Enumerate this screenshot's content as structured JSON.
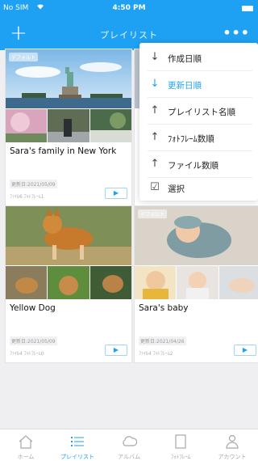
{
  "status": {
    "carrier": "No SIM",
    "time": "4:50 PM"
  },
  "nav": {
    "title": "プレイリスト",
    "add": "+",
    "more": "•••"
  },
  "cards": [
    {
      "tag": "デフォルト",
      "title": "Sara's family in New York",
      "date": "更新日:2021/05/09",
      "counts": "ﾌｧｲﾙ6  ﾌｫﾄﾌﾚｰﾑ1",
      "play": "▶"
    },
    {
      "tag": "",
      "title": "",
      "date": "",
      "counts": "",
      "play": ""
    },
    {
      "tag": "",
      "title": "Yellow Dog",
      "date": "更新日:2021/05/09",
      "counts": "ﾌｧｲﾙ4  ﾌｫﾄﾌﾚｰﾑ0",
      "play": "▶"
    },
    {
      "tag": "デフォルト",
      "title": "Sara's baby",
      "date": "更新日:2021/04/26",
      "counts": "ﾌｧｲﾙ4  ﾌｫﾄﾌﾚｰﾑ2",
      "play": "▶"
    }
  ],
  "sort_menu": [
    {
      "symbol": "↓",
      "label": "作成日順",
      "active": false
    },
    {
      "symbol": "↓",
      "label": "更新日順",
      "active": true
    },
    {
      "symbol": "↑",
      "label": "プレイリスト名順",
      "active": false
    },
    {
      "symbol": "↑",
      "label": "ﾌｫﾄﾌﾚｰﾑ数順",
      "active": false
    },
    {
      "symbol": "↑",
      "label": "ファイル数順",
      "active": false
    },
    {
      "symbol": "☑",
      "label": "選択",
      "active": false
    }
  ],
  "tabs": [
    {
      "label": "ホーム",
      "icon": "home-icon",
      "active": false
    },
    {
      "label": "プレイリスト",
      "icon": "list-icon",
      "active": true
    },
    {
      "label": "アルバム",
      "icon": "cloud-icon",
      "active": false
    },
    {
      "label": "ﾌｫﾄﾌﾚｰﾑ",
      "icon": "frame-icon",
      "active": false
    },
    {
      "label": "アカウント",
      "icon": "person-icon",
      "active": false
    }
  ],
  "colors": {
    "accent": "#1ea1f2",
    "background": "#efeff2"
  }
}
